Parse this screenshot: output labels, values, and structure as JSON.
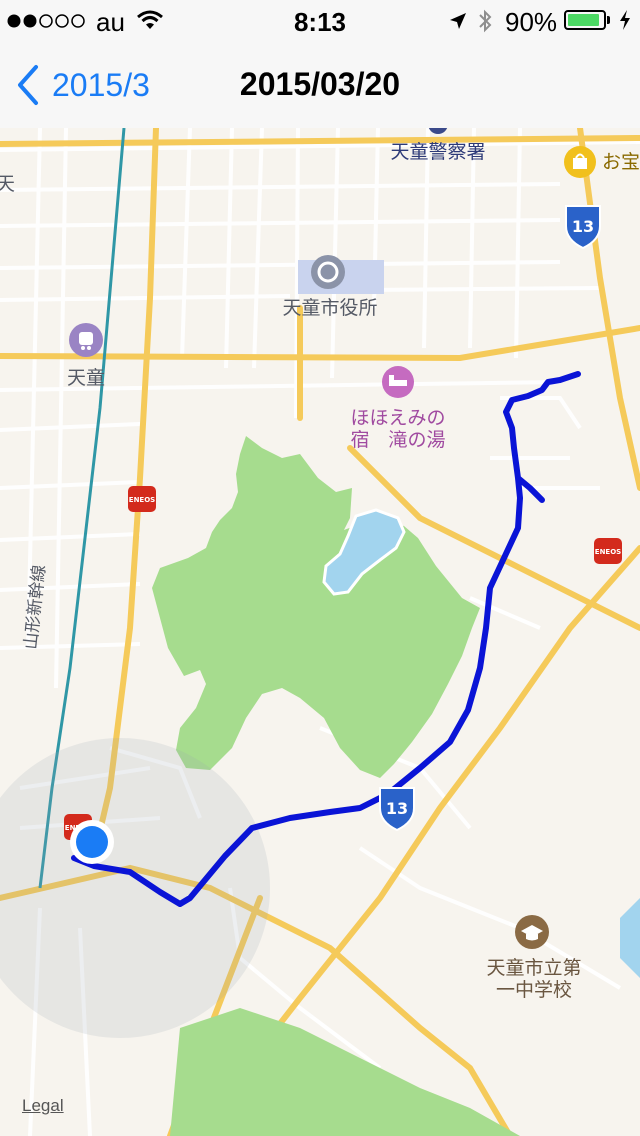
{
  "status_bar": {
    "carrier": "au",
    "signal_dots": 5,
    "signal_filled": 2,
    "time": "8:13",
    "battery": "90%",
    "battery_level": 0.9
  },
  "nav": {
    "back_label": "2015/3",
    "title": "2015/03/20"
  },
  "map": {
    "labels": {
      "police": "天童警察署",
      "city_hall": "天童市役所",
      "station": "天童",
      "hotel_line1": "ほほえみの",
      "hotel_line2": "宿　滝の湯",
      "school_line1": "天童市立第",
      "school_line2": "一中学校",
      "railway": "山形新幹線",
      "shop_partial": "お宝",
      "edge_partial": "天"
    },
    "route_shields": [
      "13",
      "13"
    ],
    "gas_station_brand": "ENEOS",
    "legal": "Legal",
    "colors": {
      "route": "#0a14d6",
      "park": "#a6dc8e",
      "water": "#a2d4ee",
      "road_major": "#f5ca5a",
      "location_dot": "#1a7cf5",
      "accent": "#1a7cf5"
    }
  }
}
